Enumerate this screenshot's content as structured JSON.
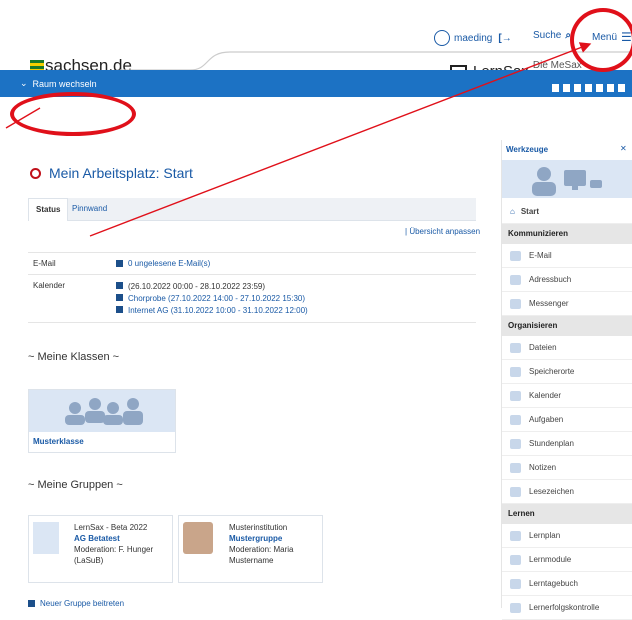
{
  "top": {
    "user": "maeding",
    "search": "Suche",
    "menu": "Menü"
  },
  "brand": {
    "sachsen": "sachsen.de",
    "lernsax": "LernSax",
    "tagline": "Die MeSax - Schulcloud"
  },
  "bar": {
    "room_switch": "Raum wechseln"
  },
  "page": {
    "title": "Mein Arbeitsplatz: Start"
  },
  "tabs": [
    "Status",
    "Pinnwand"
  ],
  "overview_link": "Übersicht anpassen",
  "email": {
    "label": "E-Mail",
    "value": "0 ungelesene E-Mail(s)"
  },
  "calendar": {
    "label": "Kalender",
    "entries": [
      "(26.10.2022 00:00 - 28.10.2022 23:59)",
      "Chorprobe (27.10.2022 14:00 - 27.10.2022 15:30)",
      "Internet AG (31.10.2022 10:00 - 31.10.2022 12:00)"
    ]
  },
  "classes": {
    "title": "~ Meine Klassen ~",
    "items": [
      "Musterklasse"
    ]
  },
  "groups": {
    "title": "~ Meine Gruppen ~",
    "items": [
      {
        "org": "LernSax - Beta 2022",
        "name": "AG Betatest",
        "mod1": "Moderation: F. Hunger",
        "mod2": "(LaSuB)"
      },
      {
        "org": "Musterinstitution",
        "name": "Mustergruppe",
        "mod1": "Moderation: Maria",
        "mod2": "Mustername"
      }
    ],
    "join": "Neuer Gruppe beitreten"
  },
  "sidebar": {
    "tools": "Werkzeuge",
    "start": "Start",
    "sections": [
      {
        "title": "Kommunizieren",
        "items": [
          "E-Mail",
          "Adressbuch",
          "Messenger"
        ]
      },
      {
        "title": "Organisieren",
        "items": [
          "Dateien",
          "Speicherorte",
          "Kalender",
          "Aufgaben",
          "Stundenplan",
          "Notizen",
          "Lesezeichen"
        ]
      },
      {
        "title": "Lernen",
        "items": [
          "Lernplan",
          "Lernmodule",
          "Lerntagebuch",
          "Lernerfolgskontrolle"
        ]
      }
    ]
  },
  "colors": {
    "accent": "#1c72c4",
    "annotation": "#e0101a",
    "title_icon": "#c0101a"
  }
}
